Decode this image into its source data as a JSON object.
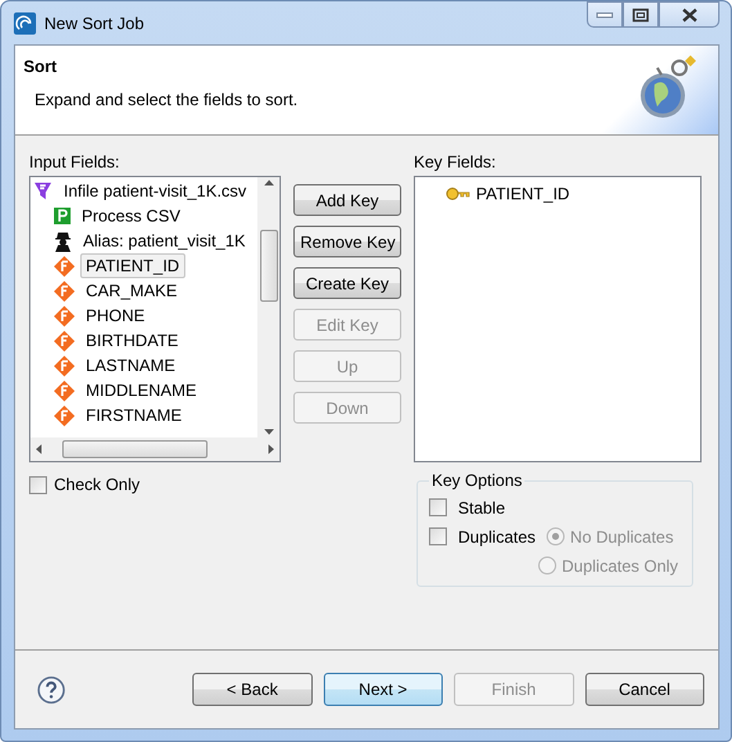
{
  "window": {
    "title": "New Sort Job"
  },
  "header": {
    "title": "Sort",
    "description": "Expand and select the fields to sort."
  },
  "input_fields": {
    "label": "Input Fields:",
    "tree": [
      {
        "text": "Infile patient-visit_1K.csv",
        "kind": "file",
        "selected": false,
        "children": [
          {
            "text": "Process CSV",
            "kind": "process",
            "selected": false
          },
          {
            "text": "Alias: patient_visit_1K",
            "kind": "alias",
            "selected": false
          },
          {
            "text": "PATIENT_ID",
            "kind": "field",
            "selected": true
          },
          {
            "text": "CAR_MAKE",
            "kind": "field",
            "selected": false
          },
          {
            "text": "PHONE",
            "kind": "field",
            "selected": false
          },
          {
            "text": "BIRTHDATE",
            "kind": "field",
            "selected": false
          },
          {
            "text": "LASTNAME",
            "kind": "field",
            "selected": false
          },
          {
            "text": "MIDDLENAME",
            "kind": "field",
            "selected": false
          },
          {
            "text": "FIRSTNAME",
            "kind": "field",
            "selected": false
          }
        ]
      }
    ]
  },
  "key_buttons": [
    {
      "label": "Add Key",
      "disabled": false
    },
    {
      "label": "Remove Key",
      "disabled": false
    },
    {
      "label": "Create Key",
      "disabled": false
    },
    {
      "label": "Edit Key",
      "disabled": true
    },
    {
      "label": "Up",
      "disabled": true
    },
    {
      "label": "Down",
      "disabled": true
    }
  ],
  "key_fields": {
    "label": "Key Fields:",
    "items": [
      "PATIENT_ID"
    ]
  },
  "check_only": {
    "label": "Check Only",
    "checked": false
  },
  "key_options": {
    "title": "Key Options",
    "stable": {
      "label": "Stable",
      "checked": false
    },
    "duplicates": {
      "label": "Duplicates",
      "checked": false
    },
    "radios": [
      {
        "label": "No Duplicates",
        "selected": true,
        "disabled": true
      },
      {
        "label": "Duplicates Only",
        "selected": false,
        "disabled": true
      }
    ]
  },
  "footer_buttons": [
    {
      "label": "< Back",
      "default": false,
      "disabled": false
    },
    {
      "label": "Next >",
      "default": true,
      "disabled": false
    },
    {
      "label": "Finish",
      "default": false,
      "disabled": true
    },
    {
      "label": "Cancel",
      "default": false,
      "disabled": false
    }
  ]
}
